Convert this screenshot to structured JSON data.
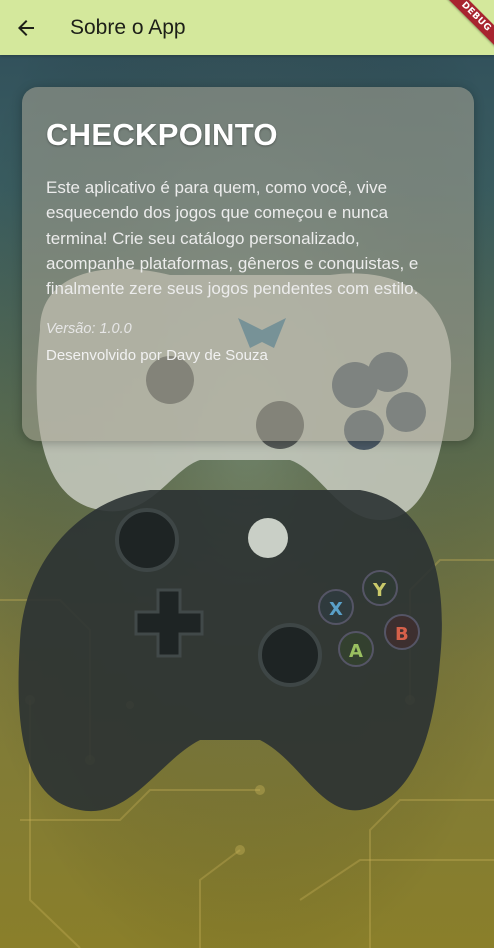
{
  "appbar": {
    "title": "Sobre o App",
    "back_icon": "arrow-back-icon",
    "color": "#d4e89c"
  },
  "debug_banner": "DEBUG",
  "card": {
    "title": "CHECKPOINTO",
    "description": "Este aplicativo é para quem, como você, vive esquecendo dos jogos que começou e nunca termina! Crie seu catálogo personalizado, acompanhe plataformas, gêneros e conquistas, e finalmente zere seus jogos pendentes com estilo.",
    "version": "Versão: 1.0.0",
    "developer": "Desenvolvido por Davy de Souza"
  },
  "background": {
    "subject": "game-controllers-illustration",
    "controller_letters": [
      "Y",
      "X",
      "B",
      "A"
    ]
  }
}
